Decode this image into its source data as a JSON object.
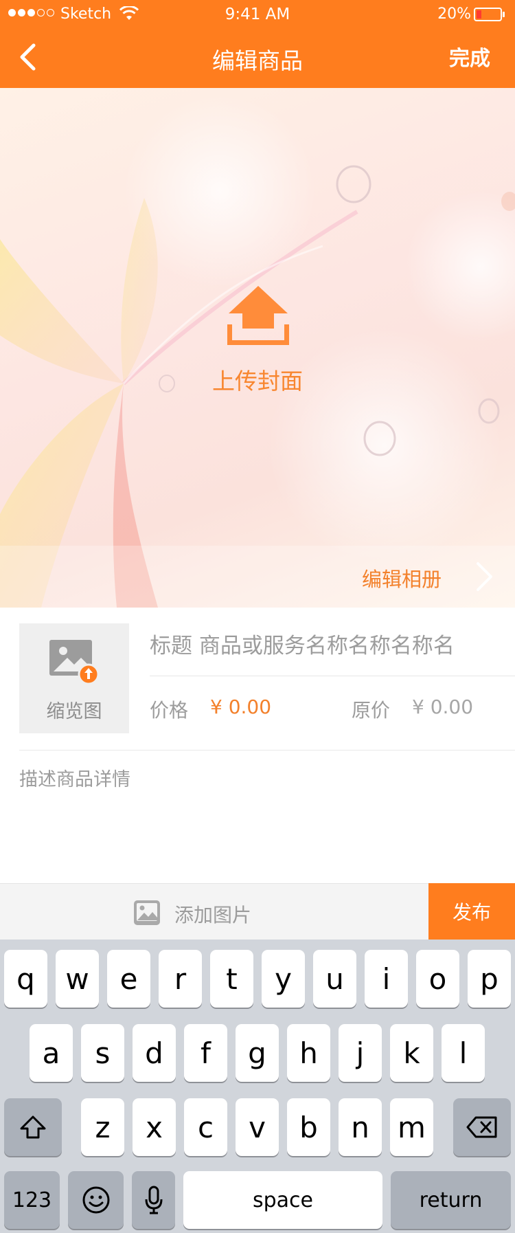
{
  "status_bar": {
    "carrier": "Sketch",
    "time": "9:41 AM",
    "battery": "20%"
  },
  "nav": {
    "title": "编辑商品",
    "done_label": "完成"
  },
  "cover": {
    "upload_label": "上传封面",
    "album_label": "编辑相册"
  },
  "product": {
    "thumbnail_label": "缩览图",
    "title_placeholder": "标题 商品或服务名称名称名称名",
    "price_label": "价格",
    "price_value": "¥ 0.00",
    "original_price_label": "原价",
    "original_price_value": "¥ 0.00",
    "description_placeholder": "描述商品详情"
  },
  "toolbar": {
    "add_image_label": "添加图片",
    "publish_label": "发布"
  },
  "keyboard": {
    "row1": [
      "q",
      "w",
      "e",
      "r",
      "t",
      "y",
      "u",
      "i",
      "o",
      "p"
    ],
    "row2": [
      "a",
      "s",
      "d",
      "f",
      "g",
      "h",
      "j",
      "k",
      "l"
    ],
    "row3": [
      "z",
      "x",
      "c",
      "v",
      "b",
      "n",
      "m"
    ],
    "numbers_label": "123",
    "space_label": "space",
    "return_label": "return"
  },
  "colors": {
    "accent": "#ff7d1e",
    "accent_text": "#f3812c",
    "keyboard_bg": "#d1d5db"
  }
}
